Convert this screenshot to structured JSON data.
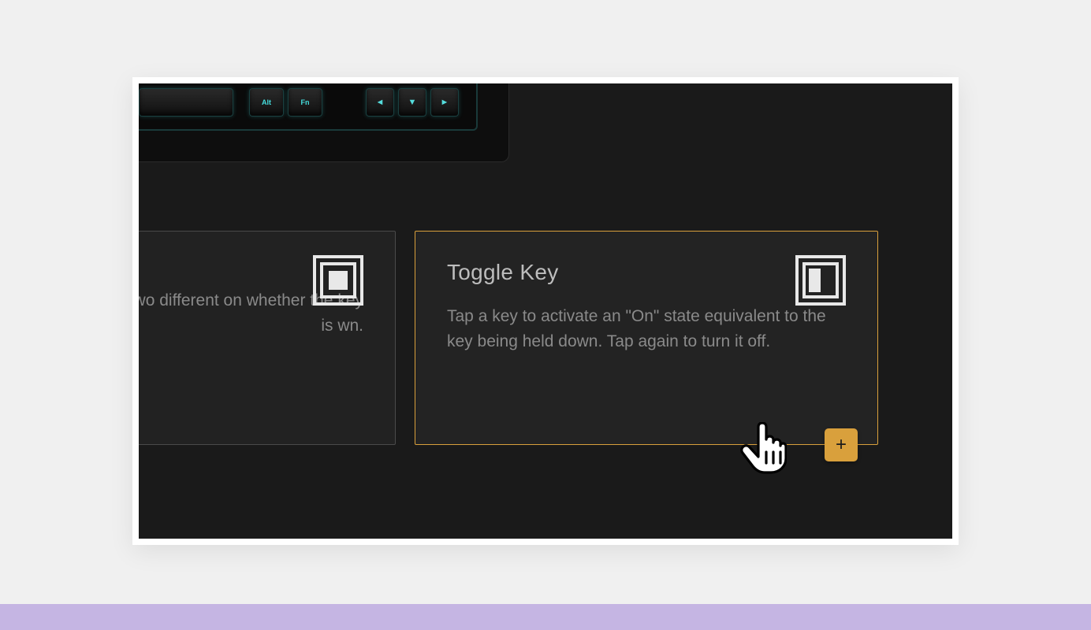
{
  "keyboard": {
    "keys": {
      "alt": "Alt",
      "fn": "Fn",
      "arrow_left": "◄",
      "arrow_down": "▼",
      "arrow_right": "►"
    }
  },
  "cards": {
    "left": {
      "title": "",
      "description": " to have two different  on whether the key is wn."
    },
    "right": {
      "title": "Toggle Key",
      "description": "Tap a key to activate an \"On\" state equivalent to the key being held down. Tap again to turn it off."
    }
  },
  "plus_button": {
    "glyph": "+"
  },
  "colors": {
    "accent": "#d9a03c",
    "background": "#1a1a1a",
    "card_bg": "#222222",
    "text_primary": "#bdbdbd",
    "text_secondary": "#8a8a8a"
  }
}
